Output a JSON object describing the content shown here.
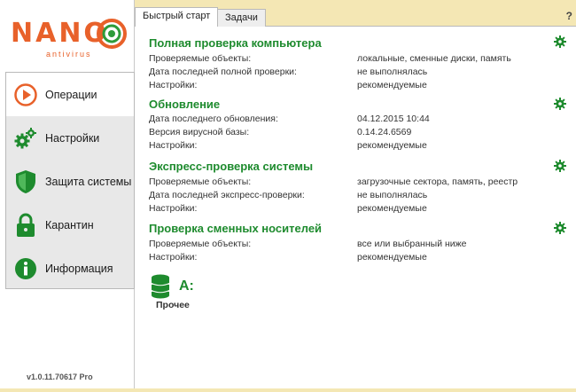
{
  "logo": {
    "title": "NANO",
    "subtitle": "antivirus"
  },
  "nav": [
    {
      "label": "Операции",
      "icon": "operations-play-icon"
    },
    {
      "label": "Настройки",
      "icon": "gears-icon"
    },
    {
      "label": "Защита системы",
      "icon": "shield-icon"
    },
    {
      "label": "Карантин",
      "icon": "lock-icon"
    },
    {
      "label": "Информация",
      "icon": "info-icon"
    }
  ],
  "version": "v1.0.11.70617 Pro",
  "tabs": [
    {
      "label": "Быстрый старт"
    },
    {
      "label": "Задачи"
    }
  ],
  "help": "?",
  "sections": [
    {
      "title": "Полная проверка компьютера",
      "rows": [
        {
          "label": "Проверяемые объекты:",
          "value": "локальные, сменные диски, память"
        },
        {
          "label": "Дата последней полной проверки:",
          "value": "не выполнялась"
        },
        {
          "label": "Настройки:",
          "value": "рекомендуемые"
        }
      ]
    },
    {
      "title": "Обновление",
      "rows": [
        {
          "label": "Дата последнего обновления:",
          "value": "04.12.2015 10:44"
        },
        {
          "label": "Версия вирусной базы:",
          "value": "0.14.24.6569"
        },
        {
          "label": "Настройки:",
          "value": "рекомендуемые"
        }
      ]
    },
    {
      "title": "Экспресс-проверка системы",
      "rows": [
        {
          "label": "Проверяемые объекты:",
          "value": "загрузочные сектора, память, реестр"
        },
        {
          "label": "Дата последней экспресс-проверки:",
          "value": "не выполнялась"
        },
        {
          "label": "Настройки:",
          "value": "рекомендуемые"
        }
      ]
    },
    {
      "title": "Проверка сменных носителей",
      "rows": [
        {
          "label": "Проверяемые объекты:",
          "value": "все или выбранный ниже"
        },
        {
          "label": "Настройки:",
          "value": "рекомендуемые"
        }
      ]
    }
  ],
  "drive": {
    "letter": "A:",
    "label": "Прочее"
  },
  "colors": {
    "accent_green": "#1e8b2e",
    "brand_orange": "#e8612a",
    "background_band": "#f4e7b4"
  }
}
